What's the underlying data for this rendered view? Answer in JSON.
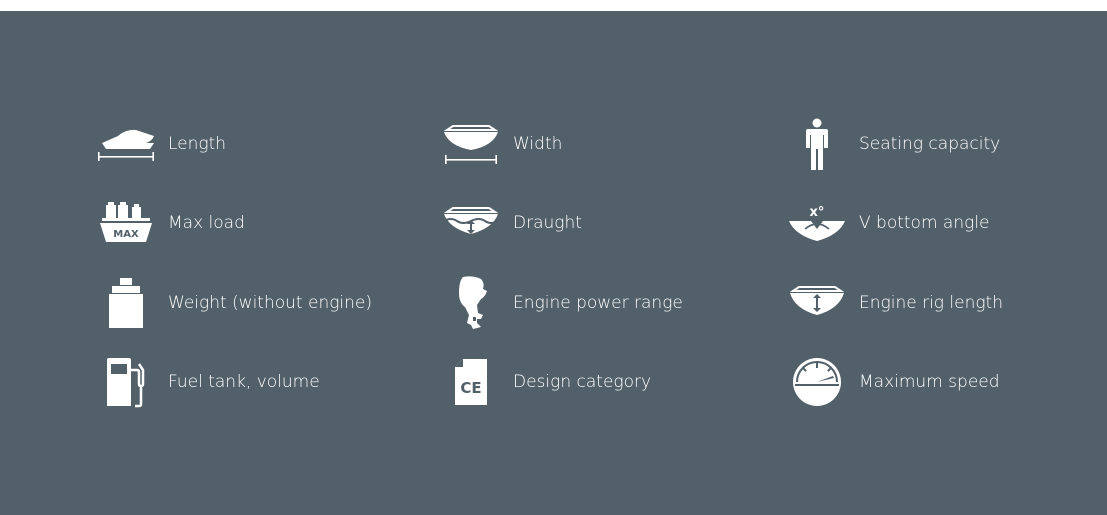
{
  "specs": [
    {
      "label": "Length",
      "icon": "boat-length-icon"
    },
    {
      "label": "Width",
      "icon": "boat-width-icon"
    },
    {
      "label": "Seating capacity",
      "icon": "person-icon"
    },
    {
      "label": "Max load",
      "icon": "max-load-icon"
    },
    {
      "label": "Draught",
      "icon": "draught-icon"
    },
    {
      "label": "V bottom angle",
      "icon": "v-bottom-angle-icon"
    },
    {
      "label": "Weight (without engine)",
      "icon": "weight-icon"
    },
    {
      "label": "Engine power range",
      "icon": "outboard-engine-icon"
    },
    {
      "label": "Engine rig length",
      "icon": "engine-rig-length-icon"
    },
    {
      "label": "Fuel tank, volume",
      "icon": "fuel-pump-icon"
    },
    {
      "label": "Design category",
      "icon": "ce-document-icon"
    },
    {
      "label": "Maximum speed",
      "icon": "speedometer-icon"
    }
  ],
  "icon_texts": {
    "max_load": "MAX",
    "v_bottom_angle": "x°",
    "design_category": "CE"
  },
  "colors": {
    "background": "#526069",
    "foreground": "#ffffff"
  }
}
